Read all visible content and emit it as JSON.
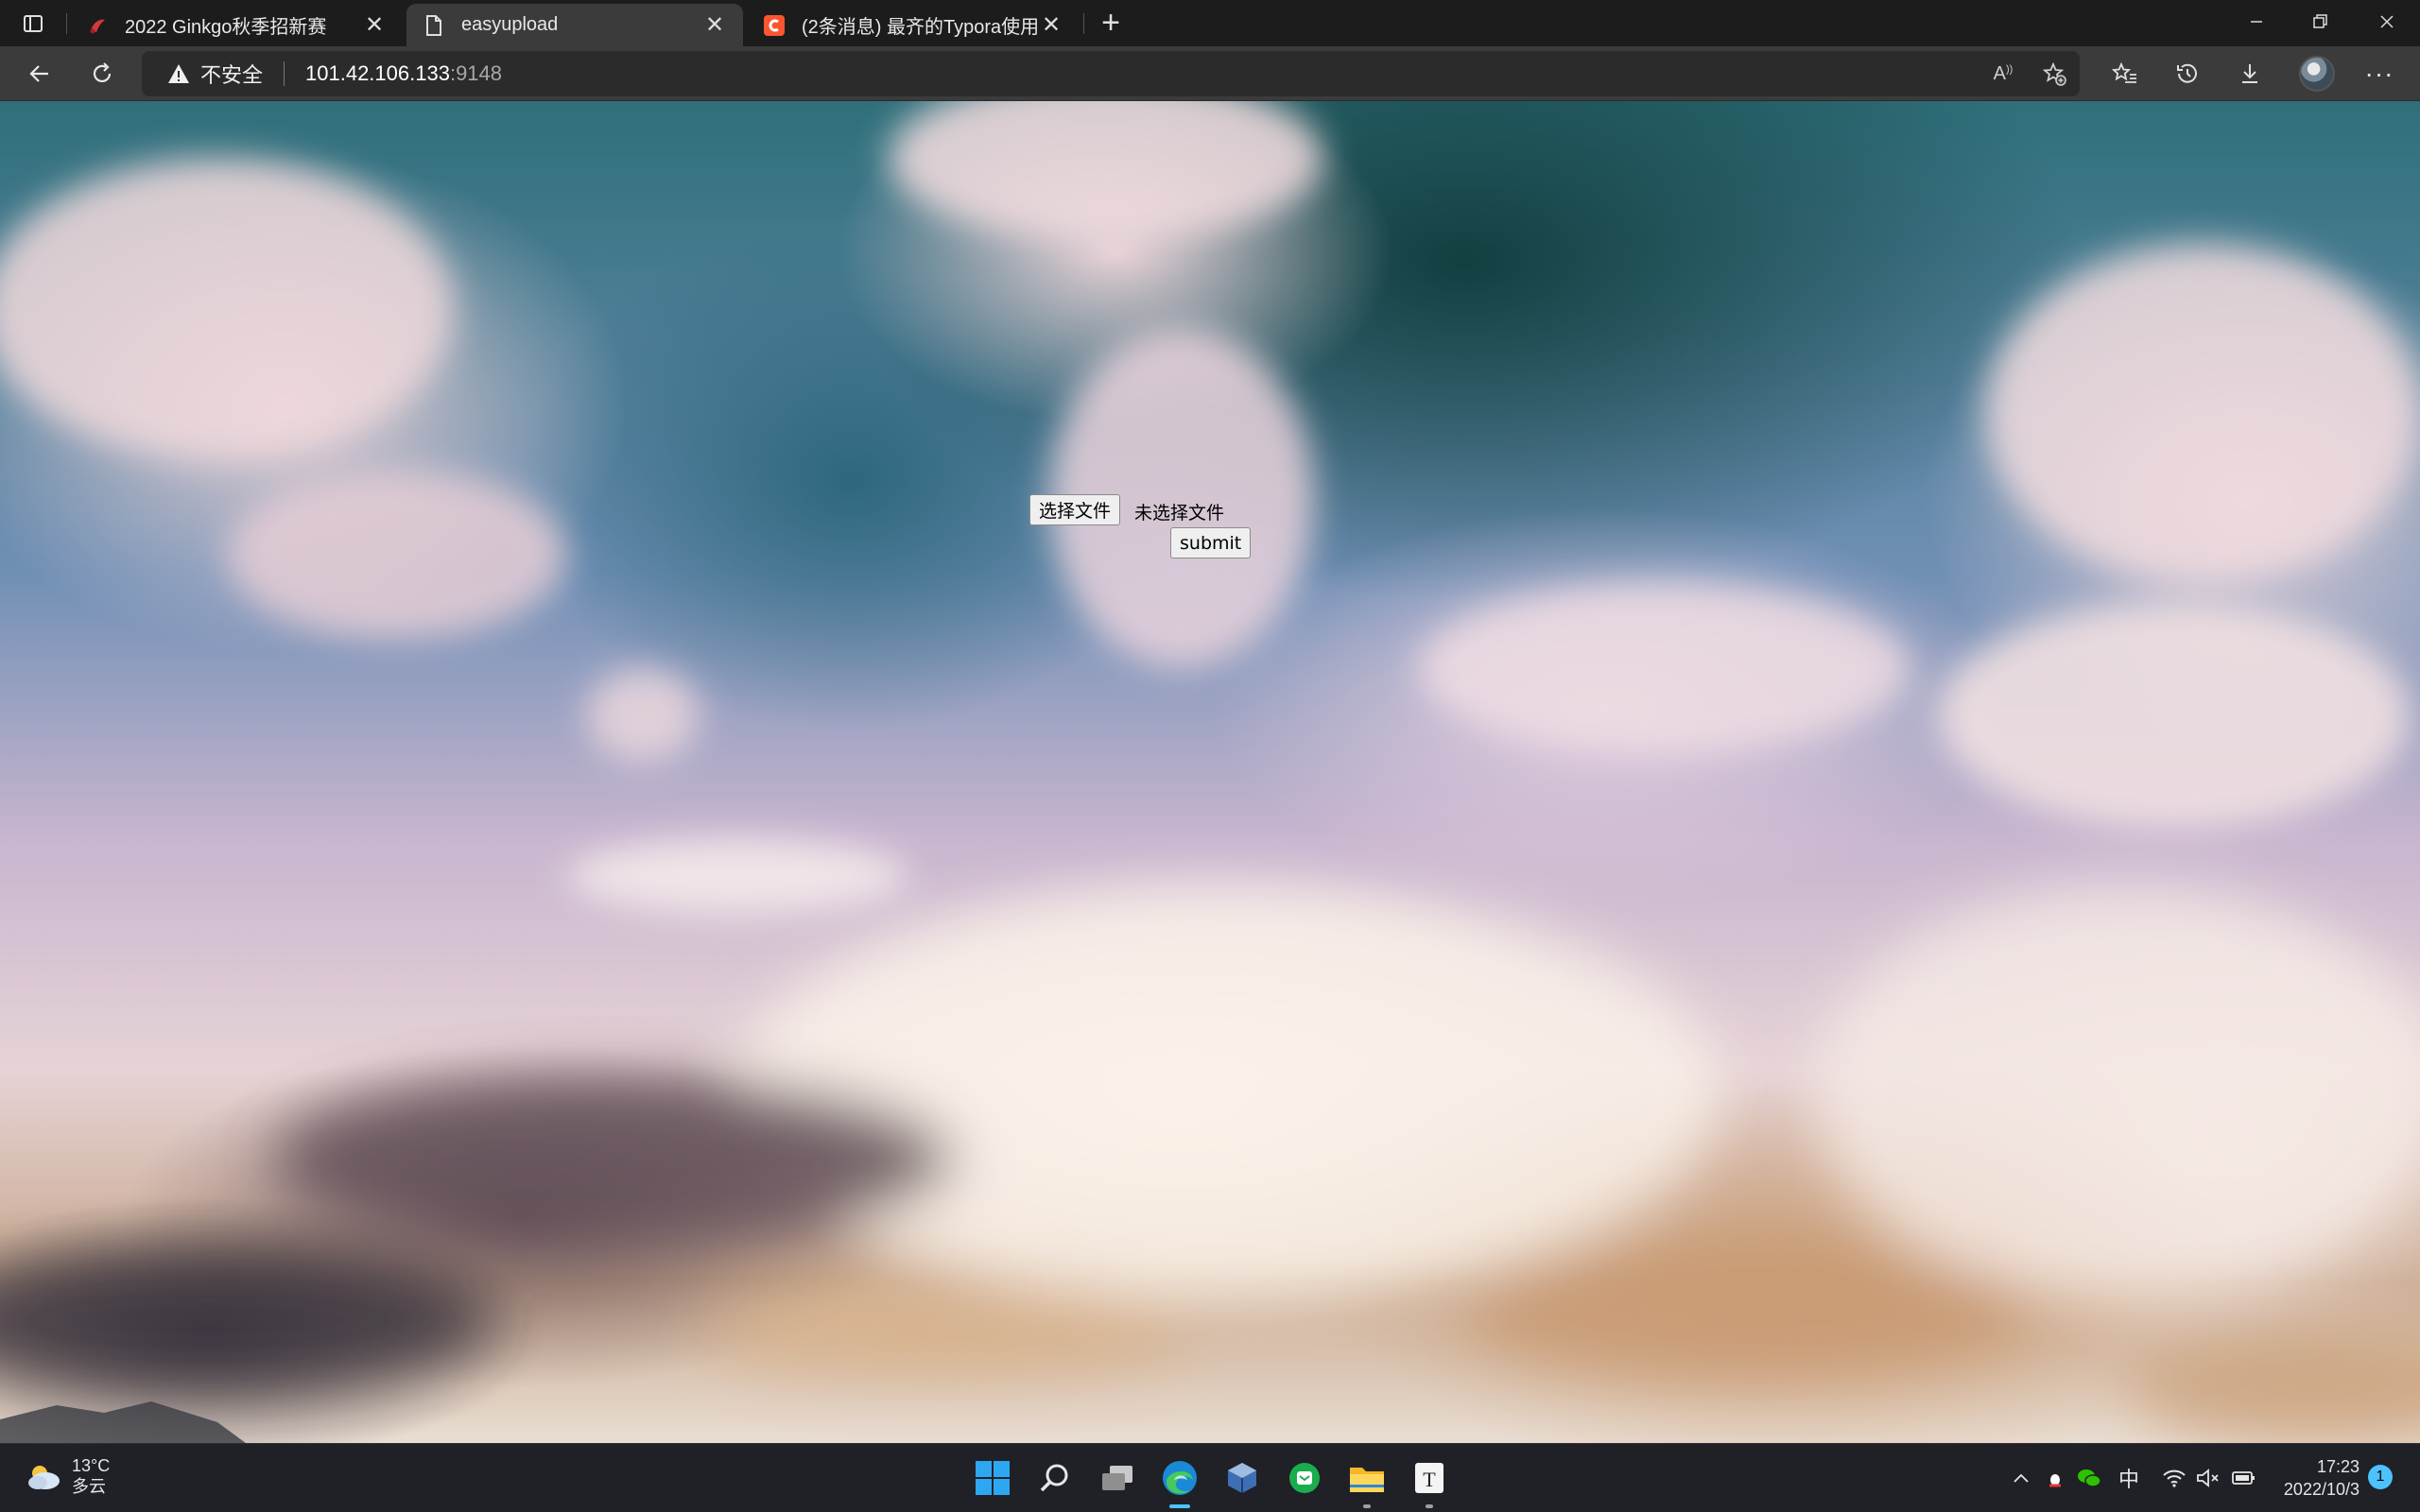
{
  "browser": {
    "tabs": [
      {
        "title": "2022 Ginkgo秋季招新赛",
        "favicon": "ginkgo-logo-icon",
        "active": false
      },
      {
        "title": "easyupload",
        "favicon": "document-icon",
        "active": true
      },
      {
        "title": "(2条消息) 最齐的Typora使用教程",
        "favicon": "csdn-logo-icon",
        "active": false
      }
    ],
    "address": {
      "security_label": "不安全",
      "host": "101.42.106.133",
      "port": ":9148"
    }
  },
  "page": {
    "file_button_label": "选择文件",
    "file_status": "未选择文件",
    "submit_label": "submit"
  },
  "taskbar": {
    "weather": {
      "temp": "13°C",
      "condition": "多云"
    },
    "ime": "中",
    "clock": {
      "time": "17:23",
      "date": "2022/10/3"
    },
    "notification_count": "1"
  },
  "colors": {
    "accent": "#4cc2ff",
    "tab_active": "#3b3b3b",
    "tab_strip": "#1c1c1c"
  }
}
